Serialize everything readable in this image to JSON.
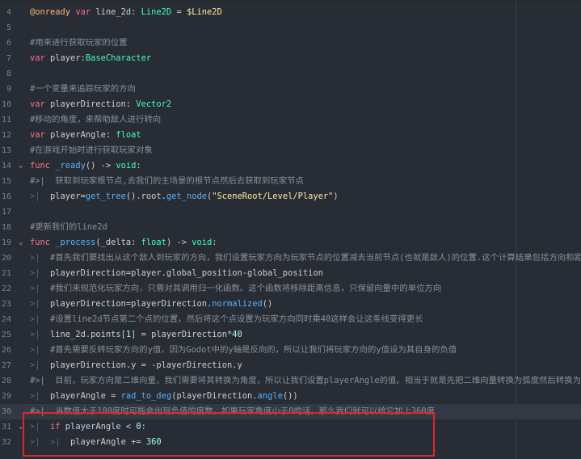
{
  "editor": {
    "lines": [
      {
        "num": "4",
        "fold": "",
        "tokens": [
          [
            "nd",
            "@onready"
          ],
          [
            "pl",
            " "
          ],
          [
            "kw",
            "var"
          ],
          [
            "pl",
            " line_2d: "
          ],
          [
            "ty",
            "Line2D"
          ],
          [
            "pl",
            " = "
          ],
          [
            "str",
            "$Line2D"
          ]
        ]
      },
      {
        "num": "5",
        "fold": "",
        "tokens": []
      },
      {
        "num": "6",
        "fold": "",
        "tokens": [
          [
            "cm",
            "#用来进行获取玩家的位置"
          ]
        ]
      },
      {
        "num": "7",
        "fold": "",
        "tokens": [
          [
            "kw",
            "var"
          ],
          [
            "pl",
            " player:"
          ],
          [
            "ty",
            "BaseCharacter"
          ]
        ]
      },
      {
        "num": "8",
        "fold": "",
        "tokens": []
      },
      {
        "num": "9",
        "fold": "",
        "tokens": [
          [
            "cm",
            "#一个变量来追踪玩家的方向"
          ]
        ]
      },
      {
        "num": "10",
        "fold": "",
        "tokens": [
          [
            "kw",
            "var"
          ],
          [
            "pl",
            " playerDirection: "
          ],
          [
            "ty",
            "Vector2"
          ]
        ]
      },
      {
        "num": "11",
        "fold": "",
        "tokens": [
          [
            "cm",
            "#移动的角度，来帮助敌人进行转向"
          ]
        ]
      },
      {
        "num": "12",
        "fold": "",
        "tokens": [
          [
            "kw",
            "var"
          ],
          [
            "pl",
            " playerAngle: "
          ],
          [
            "ty",
            "float"
          ]
        ]
      },
      {
        "num": "13",
        "fold": "",
        "tokens": [
          [
            "cm",
            "#在游戏开始时进行获取玩家对象"
          ]
        ]
      },
      {
        "num": "14",
        "fold": "⌄",
        "tokens": [
          [
            "kw",
            "func"
          ],
          [
            "pl",
            " "
          ],
          [
            "fn",
            "_ready"
          ],
          [
            "pl",
            "() -> "
          ],
          [
            "ty",
            "void"
          ],
          [
            "pl",
            ":"
          ]
        ]
      },
      {
        "num": "15",
        "fold": "",
        "tokens": [
          [
            "cm",
            "#>|  获取到玩家根节点,去我们的主场景的根节点然后去获取到玩家节点"
          ]
        ]
      },
      {
        "num": "16",
        "fold": "",
        "tokens": [
          [
            "tab",
            ">|  "
          ],
          [
            "pl",
            "player="
          ],
          [
            "fn",
            "get_tree"
          ],
          [
            "pl",
            "().root."
          ],
          [
            "fn",
            "get_node"
          ],
          [
            "pl",
            "("
          ],
          [
            "str",
            "\"SceneRoot/Level/Player\""
          ],
          [
            "pl",
            ")"
          ]
        ]
      },
      {
        "num": "17",
        "fold": "",
        "tokens": []
      },
      {
        "num": "18",
        "fold": "",
        "tokens": [
          [
            "cm",
            "#更新我们的line2d"
          ]
        ]
      },
      {
        "num": "19",
        "fold": "⌄",
        "tokens": [
          [
            "kw",
            "func"
          ],
          [
            "pl",
            " "
          ],
          [
            "fn",
            "_process"
          ],
          [
            "pl",
            "(_delta: "
          ],
          [
            "ty",
            "float"
          ],
          [
            "pl",
            ") -> "
          ],
          [
            "ty",
            "void"
          ],
          [
            "pl",
            ":"
          ]
        ]
      },
      {
        "num": "20",
        "fold": "",
        "tokens": [
          [
            "tab",
            ">|  "
          ],
          [
            "cm",
            "#首先我们要找出从这个敌人到玩家的方向，我们设置玩家方向为玩家节点的位置减去当前节点(也就是敌人)的位置.这个计算结果包括方向和距离"
          ]
        ]
      },
      {
        "num": "21",
        "fold": "",
        "tokens": [
          [
            "tab",
            ">|  "
          ],
          [
            "pl",
            "playerDirection=player.global_position-global_position"
          ]
        ]
      },
      {
        "num": "22",
        "fold": "",
        "tokens": [
          [
            "tab",
            ">|  "
          ],
          [
            "cm",
            "#我们来规范化玩家方向，只需对其调用归一化函数。这个函数将移除距离信息，只保留向量中的单位方向"
          ]
        ]
      },
      {
        "num": "23",
        "fold": "",
        "tokens": [
          [
            "tab",
            ">|  "
          ],
          [
            "pl",
            "playerDirection=playerDirection."
          ],
          [
            "fn",
            "normalized"
          ],
          [
            "pl",
            "()"
          ]
        ]
      },
      {
        "num": "24",
        "fold": "",
        "tokens": [
          [
            "tab",
            ">|  "
          ],
          [
            "cm",
            "#设置line2d节点第二个点的位置，然后将这个点设置为玩家方向同时乘40这样会让这条线变得更长"
          ]
        ]
      },
      {
        "num": "25",
        "fold": "",
        "tokens": [
          [
            "tab",
            ">|  "
          ],
          [
            "pl",
            "line_2d.points["
          ],
          [
            "num",
            "1"
          ],
          [
            "pl",
            "] = playerDirection*"
          ],
          [
            "num",
            "40"
          ]
        ]
      },
      {
        "num": "26",
        "fold": "",
        "tokens": [
          [
            "tab",
            ">|  "
          ],
          [
            "cm",
            "#首先需要反转玩家方向的y值，因为Godot中的y轴是反向的，所以让我们将玩家方向的y值设为其自身的负值"
          ]
        ]
      },
      {
        "num": "27",
        "fold": "",
        "tokens": [
          [
            "tab",
            ">|  "
          ],
          [
            "pl",
            "playerDirection.y = -playerDirection.y"
          ]
        ]
      },
      {
        "num": "28",
        "fold": "",
        "tokens": [
          [
            "cm",
            "#>|  目前，玩家方向是二维向量，我们需要将其转换为角度，所以让我们设置playerAngle的值。相当于就是先把二维向量转换为弧度然后转换为度数"
          ]
        ]
      },
      {
        "num": "29",
        "fold": "",
        "tokens": [
          [
            "tab",
            ">|  "
          ],
          [
            "pl",
            "playerAngle = "
          ],
          [
            "fn",
            "rad_to_deg"
          ],
          [
            "pl",
            "(playerDirection."
          ],
          [
            "fn",
            "angle"
          ],
          [
            "pl",
            "())"
          ]
        ]
      },
      {
        "num": "30",
        "fold": "",
        "tokens": [
          [
            "cm",
            "#>|  当数值大于180度时可能会出现负值的度数，如果玩家角度小于0的话，那么我们就可以给它加上360度"
          ]
        ]
      },
      {
        "num": "31",
        "fold": "⌄",
        "tokens": [
          [
            "tab",
            ">|  "
          ],
          [
            "kw",
            "if"
          ],
          [
            "pl",
            " playerAngle < "
          ],
          [
            "num",
            "0"
          ],
          [
            "pl",
            ":"
          ]
        ]
      },
      {
        "num": "32",
        "fold": "",
        "tokens": [
          [
            "tab",
            ">|  >|  "
          ],
          [
            "pl",
            "playerAngle += "
          ],
          [
            "num",
            "360"
          ]
        ]
      }
    ]
  }
}
